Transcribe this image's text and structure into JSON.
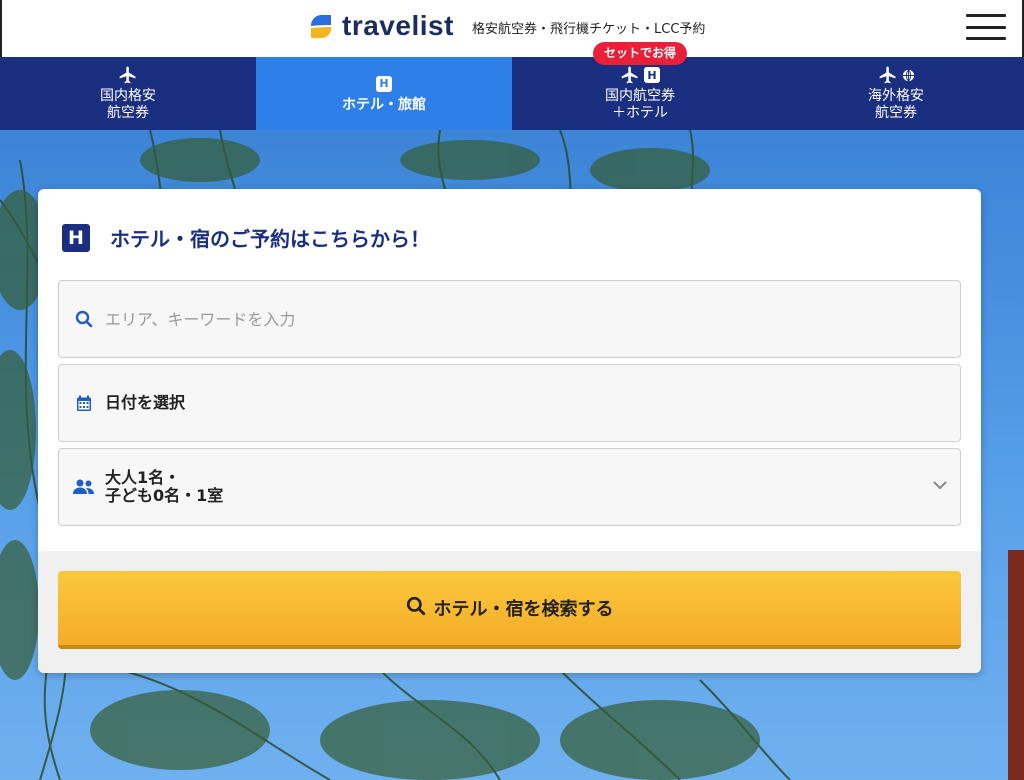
{
  "header": {
    "brand": "travelist",
    "tagline": "格安航空券・飛行機チケット・LCC予約"
  },
  "nav": {
    "tabs": [
      {
        "line1": "国内格安",
        "line2": "航空券"
      },
      {
        "line1": "ホテル・旅館",
        "line2": ""
      },
      {
        "line1": "国内航空券",
        "line2": "＋ホテル",
        "badge": "セットでお得"
      },
      {
        "line1": "海外格安",
        "line2": "航空券"
      }
    ]
  },
  "card": {
    "title": "ホテル・宿のご予約はこちらから！",
    "h_letter": "H",
    "search_placeholder": "エリア、キーワードを入力",
    "date_label": "日付を選択",
    "guests_line1": "大人1名・",
    "guests_line2": "子ども0名・1室",
    "search_button": "ホテル・宿を検索する"
  },
  "colors": {
    "navy": "#1b2f80",
    "active_tab": "#2f7fe8",
    "badge": "#e8203a",
    "button": "#f4ac28",
    "logo_blue": "#2a6fdb",
    "logo_yellow": "#f5b51e"
  },
  "icons": {
    "logo": "travelist-logo-icon",
    "menu": "hamburger-menu-icon",
    "plane": "airplane-icon",
    "hotel": "hotel-h-icon",
    "globe": "globe-icon",
    "search": "search-icon",
    "calendar": "calendar-icon",
    "people": "people-icon",
    "chevron": "chevron-down-icon"
  }
}
